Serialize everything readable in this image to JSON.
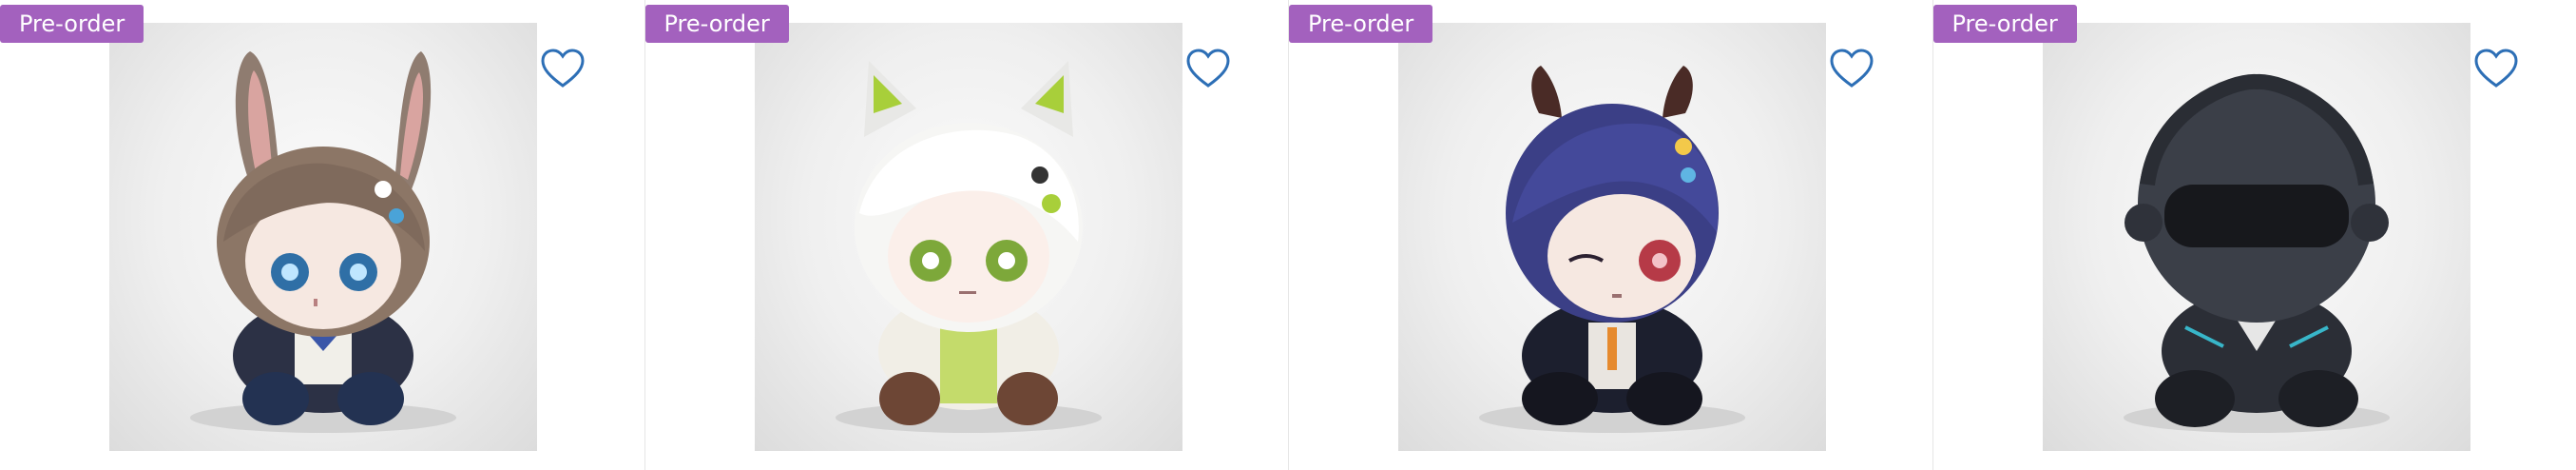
{
  "products": [
    {
      "badge": "Pre-order",
      "image_icon": "bunny-ear-girl-figure",
      "favorite_icon": "heart-outline-icon"
    },
    {
      "badge": "Pre-order",
      "image_icon": "white-hair-cat-ear-girl-figure",
      "favorite_icon": "heart-outline-icon"
    },
    {
      "badge": "Pre-order",
      "image_icon": "blue-hair-horned-girl-figure",
      "favorite_icon": "heart-outline-icon"
    },
    {
      "badge": "Pre-order",
      "image_icon": "helmeted-hooded-figure",
      "favorite_icon": "heart-outline-icon"
    }
  ],
  "colors": {
    "badge_background": "#a361be",
    "badge_text": "#ffffff",
    "heart_outline": "#2d6fb6",
    "card_divider": "#e6e6e6"
  }
}
